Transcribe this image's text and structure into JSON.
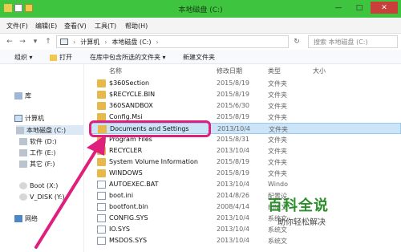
{
  "window": {
    "title": "本地磁盘 (C:)"
  },
  "menu": [
    "文件(F)",
    "编辑(E)",
    "查看(V)",
    "工具(T)",
    "帮助(H)"
  ],
  "address": {
    "path": [
      "计算机",
      "本地磁盘 (C:)"
    ],
    "search_placeholder": "搜索 本地磁盘 (C:)"
  },
  "toolbar": {
    "organize": "组织 ▾",
    "open": "打开",
    "include": "在库中包含所选的文件夹 ▾",
    "share": "共享 ▾",
    "new_folder": "新建文件夹"
  },
  "nav": {
    "library": "库",
    "computer": "计算机",
    "drives": [
      "本地磁盘 (C:)",
      "软件 (D:)",
      "工作 (E:)",
      "其它 (F:)",
      "Boot (X:)",
      "V_DISK (Y:)"
    ],
    "network": "网络"
  },
  "columns": {
    "name": "名称",
    "date": "修改日期",
    "type": "类型",
    "size": "大小"
  },
  "files": [
    {
      "name": "$360Section",
      "date": "2015/8/19",
      "type": "文件夹",
      "size": ""
    },
    {
      "name": "$RECYCLE.BIN",
      "date": "2015/8/19",
      "type": "文件夹",
      "size": ""
    },
    {
      "name": "360SANDBOX",
      "date": "2015/6/30",
      "type": "文件夹",
      "size": ""
    },
    {
      "name": "Config.Msi",
      "date": "2015/8/19",
      "type": "文件夹",
      "size": ""
    },
    {
      "name": "Documents and Settings",
      "date": "2013/10/4",
      "type": "文件夹",
      "size": ""
    },
    {
      "name": "Program Files",
      "date": "2015/8/31",
      "type": "文件夹",
      "size": ""
    },
    {
      "name": "RECYCLER",
      "date": "2013/10/4",
      "type": "文件夹",
      "size": ""
    },
    {
      "name": "System Volume Information",
      "date": "2015/8/19",
      "type": "文件夹",
      "size": ""
    },
    {
      "name": "WINDOWS",
      "date": "2015/8/19",
      "type": "文件夹",
      "size": ""
    },
    {
      "name": "AUTOEXEC.BAT",
      "date": "2013/10/4",
      "type": "Windo",
      "size": ""
    },
    {
      "name": "boot.ini",
      "date": "2014/8/26",
      "type": "配置设",
      "size": ""
    },
    {
      "name": "bootfont.bin",
      "date": "2008/4/14",
      "type": "BIN 文",
      "size": ""
    },
    {
      "name": "CONFIG.SYS",
      "date": "2013/10/4",
      "type": "系统文",
      "size": ""
    },
    {
      "name": "IO.SYS",
      "date": "2013/10/4",
      "type": "系统文",
      "size": ""
    },
    {
      "name": "MSDOS.SYS",
      "date": "2013/10/4",
      "type": "系统文",
      "size": ""
    }
  ],
  "watermark": {
    "title": "百科全说",
    "subtitle": "助你轻松解决"
  },
  "colors": {
    "titlebar": "#3fc43f",
    "highlight": "#e01e7c",
    "selection": "#cce4f7"
  }
}
